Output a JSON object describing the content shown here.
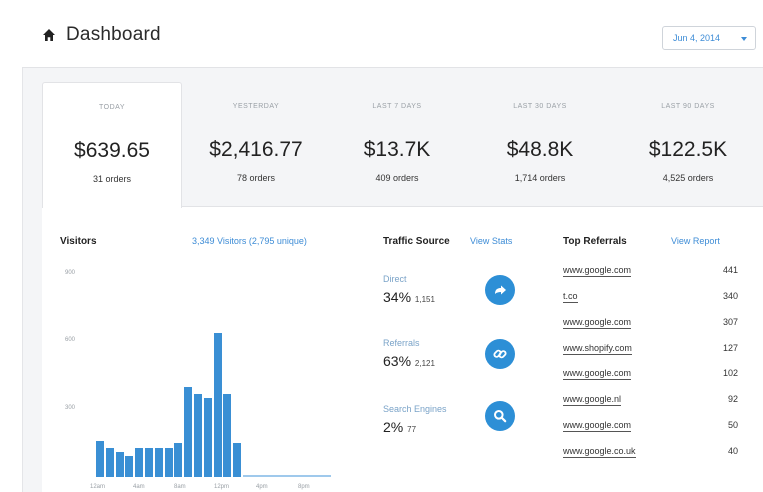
{
  "header": {
    "title": "Dashboard",
    "date": "Jun 4, 2014"
  },
  "stats": [
    {
      "label": "TODAY",
      "value": "$639.65",
      "orders": "31 orders"
    },
    {
      "label": "YESTERDAY",
      "value": "$2,416.77",
      "orders": "78 orders"
    },
    {
      "label": "LAST 7 DAYS",
      "value": "$13.7K",
      "orders": "409 orders"
    },
    {
      "label": "LAST 30 DAYS",
      "value": "$48.8K",
      "orders": "1,714 orders"
    },
    {
      "label": "LAST 90 DAYS",
      "value": "$122.5K",
      "orders": "4,525 orders"
    }
  ],
  "visitors": {
    "title": "Visitors",
    "summary": "3,349 Visitors (2,795 unique)"
  },
  "chart_data": {
    "type": "bar",
    "title": "",
    "y_ticks": [
      "900",
      "600",
      "300"
    ],
    "x_ticks": [
      "12am",
      "4am",
      "8am",
      "12pm",
      "4pm",
      "8pm"
    ],
    "ylim": [
      0,
      1000
    ],
    "values": [
      160,
      130,
      110,
      95,
      130,
      130,
      130,
      130,
      150,
      400,
      370,
      350,
      640,
      370,
      150,
      8,
      8,
      8,
      8,
      8,
      8,
      8,
      8,
      8
    ],
    "color": "#3a8fd4"
  },
  "traffic": {
    "title": "Traffic Source",
    "link": "View Stats",
    "sources": [
      {
        "label": "Direct",
        "percent": "34%",
        "count": "1,151",
        "icon": "arrow-forward-icon"
      },
      {
        "label": "Referrals",
        "percent": "63%",
        "count": "2,121",
        "icon": "link-icon"
      },
      {
        "label": "Search Engines",
        "percent": "2%",
        "count": "77",
        "icon": "search-icon"
      }
    ]
  },
  "referrals": {
    "title": "Top Referrals",
    "link": "View Report",
    "items": [
      {
        "domain": "www.google.com",
        "count": "441"
      },
      {
        "domain": "t.co",
        "count": "340"
      },
      {
        "domain": "www.google.com",
        "count": "307"
      },
      {
        "domain": "www.shopify.com",
        "count": "127"
      },
      {
        "domain": "www.google.com",
        "count": "102"
      },
      {
        "domain": "www.google.nl",
        "count": "92"
      },
      {
        "domain": "www.google.com",
        "count": "50"
      },
      {
        "domain": "www.google.co.uk",
        "count": "40"
      }
    ]
  },
  "colors": {
    "accent": "#3d8cd6",
    "bar": "#3a8fd4"
  }
}
